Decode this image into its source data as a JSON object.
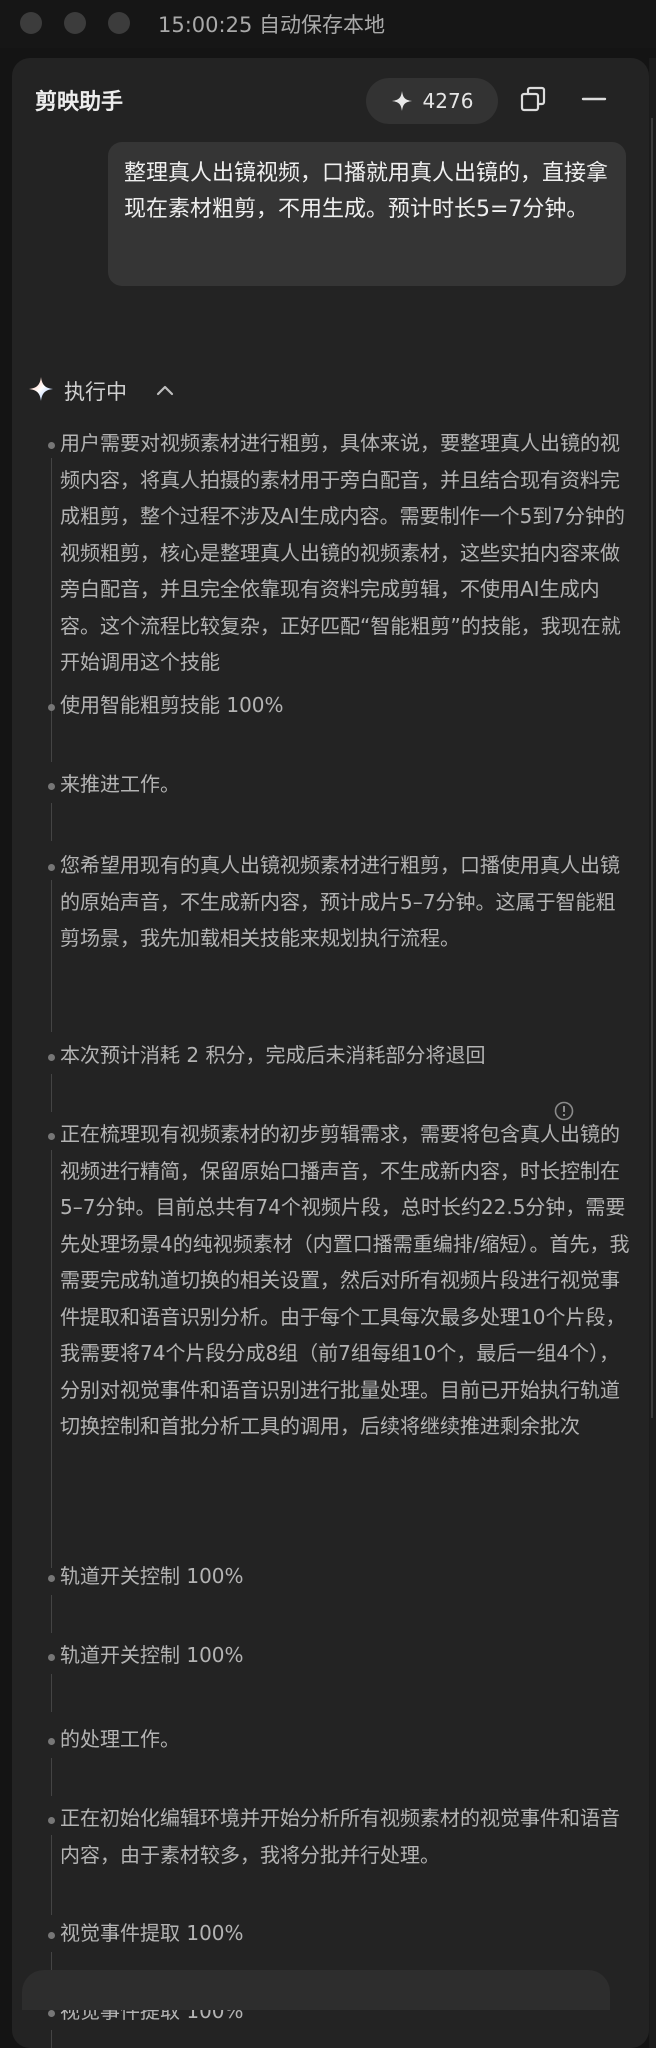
{
  "window": {
    "title_status": "15:00:25 自动保存本地"
  },
  "header": {
    "title": "剪映助手",
    "credits": "4276",
    "credit_icon": "sparkle-icon",
    "restore_icon": "window-restore-icon",
    "minimize_icon": "minimize-icon"
  },
  "user_message": "整理真人出镜视频，口播就用真人出镜的，直接拿现在素材粗剪，不用生成。预计时长5=7分钟。",
  "status": {
    "label": "执行中",
    "icon": "ai-sparkle-icon",
    "toggle_icon": "chevron-up-icon"
  },
  "steps": [
    "用户需要对视频素材进行粗剪，具体来说，要整理真人出镜的视频内容，将真人拍摄的素材用于旁白配音，并且结合现有资料完成粗剪，整个过程不涉及AI生成内容。需要制作一个5到7分钟的视频粗剪，核心是整理真人出镜的视频素材，这些实拍内容来做旁白配音，并且完全依靠现有资料完成剪辑，不使用AI生成内容。这个流程比较复杂，正好匹配“智能粗剪”的技能，我现在就开始调用这个技能",
    "使用智能粗剪技能 100%",
    "来推进工作。",
    "您希望用现有的真人出镜视频素材进行粗剪，口播使用真人出镜的原始声音，不生成新内容，预计成片5–7分钟。这属于智能粗剪场景，我先加载相关技能来规划执行流程。",
    "本次预计消耗 2 积分，完成后未消耗部分将退回",
    "正在梳理现有视频素材的初步剪辑需求，需要将包含真人出镜的视频进行精简，保留原始口播声音，不生成新内容，时长控制在5–7分钟。目前总共有74个视频片段，总时长约22.5分钟，需要先处理场景4的纯视频素材（内置口播需重编排/缩短）。首先，我需要完成轨道切换的相关设置，然后对所有视频片段进行视觉事件提取和语音识别分析。由于每个工具每次最多处理10个片段，我需要将74个片段分成8组（前7组每组10个，最后一组4个），分别对视觉事件和语音识别进行批量处理。目前已开始执行轨道切换控制和首批分析工具的调用，后续将继续推进剩余批次",
    "轨道开关控制 100%",
    "轨道开关控制 100%",
    "的处理工作。",
    "正在初始化编辑环境并开始分析所有视频素材的视觉事件和语音内容，由于素材较多，我将分批并行处理。",
    "视觉事件提取 100%",
    "视觉事件提取 100%"
  ],
  "info_icon": "info-icon"
}
